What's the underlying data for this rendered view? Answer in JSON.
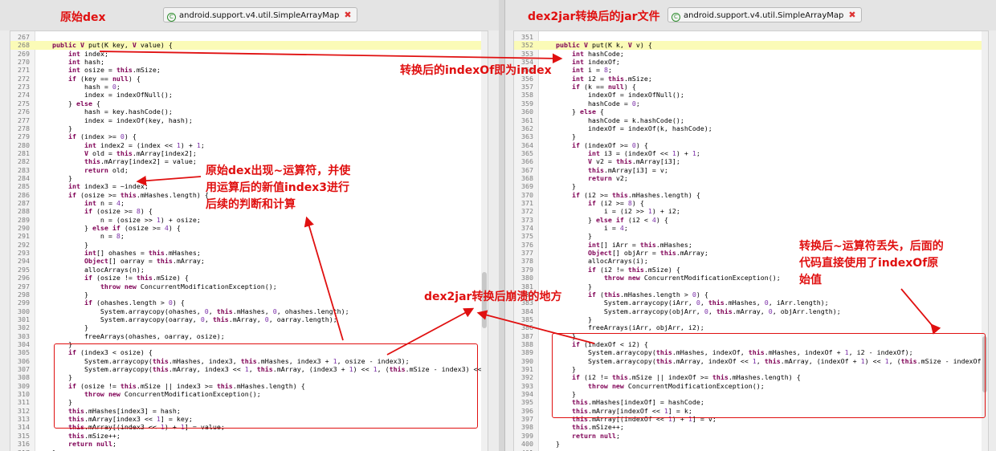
{
  "left": {
    "header_label": "原始dex",
    "tab_label": "android.support.v4.util.SimpleArrayMap",
    "tab_close": "✖",
    "lines": [
      {
        "n": "267",
        "t": ""
      },
      {
        "n": "268",
        "t": "    public V put(K key, V value) {"
      },
      {
        "n": "269",
        "t": "        int index;"
      },
      {
        "n": "270",
        "t": "        int hash;"
      },
      {
        "n": "271",
        "t": "        int osize = this.mSize;"
      },
      {
        "n": "272",
        "t": "        if (key == null) {"
      },
      {
        "n": "273",
        "t": "            hash = 0;"
      },
      {
        "n": "274",
        "t": "            index = indexOfNull();"
      },
      {
        "n": "275",
        "t": "        } else {"
      },
      {
        "n": "276",
        "t": "            hash = key.hashCode();"
      },
      {
        "n": "277",
        "t": "            index = indexOf(key, hash);"
      },
      {
        "n": "278",
        "t": "        }"
      },
      {
        "n": "279",
        "t": "        if (index >= 0) {"
      },
      {
        "n": "280",
        "t": "            int index2 = (index << 1) + 1;"
      },
      {
        "n": "281",
        "t": "            V old = this.mArray[index2];"
      },
      {
        "n": "282",
        "t": "            this.mArray[index2] = value;"
      },
      {
        "n": "283",
        "t": "            return old;"
      },
      {
        "n": "284",
        "t": "        }"
      },
      {
        "n": "285",
        "t": "        int index3 = ~index;"
      },
      {
        "n": "286",
        "t": "        if (osize >= this.mHashes.length) {"
      },
      {
        "n": "287",
        "t": "            int n = 4;"
      },
      {
        "n": "288",
        "t": "            if (osize >= 8) {"
      },
      {
        "n": "289",
        "t": "                n = (osize >> 1) + osize;"
      },
      {
        "n": "290",
        "t": "            } else if (osize >= 4) {"
      },
      {
        "n": "291",
        "t": "                n = 8;"
      },
      {
        "n": "292",
        "t": "            }"
      },
      {
        "n": "293",
        "t": "            int[] ohashes = this.mHashes;"
      },
      {
        "n": "294",
        "t": "            Object[] oarray = this.mArray;"
      },
      {
        "n": "295",
        "t": "            allocArrays(n);"
      },
      {
        "n": "296",
        "t": "            if (osize != this.mSize) {"
      },
      {
        "n": "297",
        "t": "                throw new ConcurrentModificationException();"
      },
      {
        "n": "298",
        "t": "            }"
      },
      {
        "n": "299",
        "t": "            if (ohashes.length > 0) {"
      },
      {
        "n": "300",
        "t": "                System.arraycopy(ohashes, 0, this.mHashes, 0, ohashes.length);"
      },
      {
        "n": "301",
        "t": "                System.arraycopy(oarray, 0, this.mArray, 0, oarray.length);"
      },
      {
        "n": "302",
        "t": "            }"
      },
      {
        "n": "303",
        "t": "            freeArrays(ohashes, oarray, osize);"
      },
      {
        "n": "304",
        "t": "        }"
      },
      {
        "n": "305",
        "t": "        if (index3 < osize) {"
      },
      {
        "n": "306",
        "t": "            System.arraycopy(this.mHashes, index3, this.mHashes, index3 + 1, osize - index3);"
      },
      {
        "n": "307",
        "t": "            System.arraycopy(this.mArray, index3 << 1, this.mArray, (index3 + 1) << 1, (this.mSize - index3) << 1);"
      },
      {
        "n": "308",
        "t": "        }"
      },
      {
        "n": "309",
        "t": "        if (osize != this.mSize || index3 >= this.mHashes.length) {"
      },
      {
        "n": "310",
        "t": "            throw new ConcurrentModificationException();"
      },
      {
        "n": "311",
        "t": "        }"
      },
      {
        "n": "312",
        "t": "        this.mHashes[index3] = hash;"
      },
      {
        "n": "313",
        "t": "        this.mArray[index3 << 1] = key;"
      },
      {
        "n": "314",
        "t": "        this.mArray[(index3 << 1) + 1] = value;"
      },
      {
        "n": "315",
        "t": "        this.mSize++;"
      },
      {
        "n": "316",
        "t": "        return null;"
      },
      {
        "n": "317",
        "t": "    }"
      }
    ]
  },
  "right": {
    "header_label": "dex2jar转换后的jar文件",
    "tab_label": "android.support.v4.util.SimpleArrayMap",
    "tab_close": "✖",
    "lines": [
      {
        "n": "351",
        "t": ""
      },
      {
        "n": "352",
        "t": "    public V put(K k, V v) {"
      },
      {
        "n": "353",
        "t": "        int hashCode;"
      },
      {
        "n": "354",
        "t": "        int indexOf;"
      },
      {
        "n": "355",
        "t": "        int i = 8;"
      },
      {
        "n": "356",
        "t": "        int i2 = this.mSize;"
      },
      {
        "n": "357",
        "t": "        if (k == null) {"
      },
      {
        "n": "358",
        "t": "            indexOf = indexOfNull();"
      },
      {
        "n": "359",
        "t": "            hashCode = 0;"
      },
      {
        "n": "360",
        "t": "        } else {"
      },
      {
        "n": "361",
        "t": "            hashCode = k.hashCode();"
      },
      {
        "n": "362",
        "t": "            indexOf = indexOf(k, hashCode);"
      },
      {
        "n": "363",
        "t": "        }"
      },
      {
        "n": "364",
        "t": "        if (indexOf >= 0) {"
      },
      {
        "n": "365",
        "t": "            int i3 = (indexOf << 1) + 1;"
      },
      {
        "n": "366",
        "t": "            V v2 = this.mArray[i3];"
      },
      {
        "n": "367",
        "t": "            this.mArray[i3] = v;"
      },
      {
        "n": "368",
        "t": "            return v2;"
      },
      {
        "n": "369",
        "t": "        }"
      },
      {
        "n": "370",
        "t": "        if (i2 >= this.mHashes.length) {"
      },
      {
        "n": "371",
        "t": "            if (i2 >= 8) {"
      },
      {
        "n": "372",
        "t": "                i = (i2 >> 1) + i2;"
      },
      {
        "n": "373",
        "t": "            } else if (i2 < 4) {"
      },
      {
        "n": "374",
        "t": "                i = 4;"
      },
      {
        "n": "375",
        "t": "            }"
      },
      {
        "n": "376",
        "t": "            int[] iArr = this.mHashes;"
      },
      {
        "n": "377",
        "t": "            Object[] objArr = this.mArray;"
      },
      {
        "n": "378",
        "t": "            allocArrays(i);"
      },
      {
        "n": "379",
        "t": "            if (i2 != this.mSize) {"
      },
      {
        "n": "380",
        "t": "                throw new ConcurrentModificationException();"
      },
      {
        "n": "381",
        "t": "            }"
      },
      {
        "n": "382",
        "t": "            if (this.mHashes.length > 0) {"
      },
      {
        "n": "383",
        "t": "                System.arraycopy(iArr, 0, this.mHashes, 0, iArr.length);"
      },
      {
        "n": "384",
        "t": "                System.arraycopy(objArr, 0, this.mArray, 0, objArr.length);"
      },
      {
        "n": "385",
        "t": "            }"
      },
      {
        "n": "386",
        "t": "            freeArrays(iArr, objArr, i2);"
      },
      {
        "n": "387",
        "t": "        }"
      },
      {
        "n": "388",
        "t": "        if (indexOf < i2) {"
      },
      {
        "n": "389",
        "t": "            System.arraycopy(this.mHashes, indexOf, this.mHashes, indexOf + 1, i2 - indexOf);"
      },
      {
        "n": "390",
        "t": "            System.arraycopy(this.mArray, indexOf << 1, this.mArray, (indexOf + 1) << 1, (this.mSize - indexOf) << 1);"
      },
      {
        "n": "391",
        "t": "        }"
      },
      {
        "n": "392",
        "t": "        if (i2 != this.mSize || indexOf >= this.mHashes.length) {"
      },
      {
        "n": "393",
        "t": "            throw new ConcurrentModificationException();"
      },
      {
        "n": "394",
        "t": "        }"
      },
      {
        "n": "395",
        "t": "        this.mHashes[indexOf] = hashCode;"
      },
      {
        "n": "396",
        "t": "        this.mArray[indexOf << 1] = k;"
      },
      {
        "n": "397",
        "t": "        this.mArray[(indexOf << 1) + 1] = v;"
      },
      {
        "n": "398",
        "t": "        this.mSize++;"
      },
      {
        "n": "399",
        "t": "        return null;"
      },
      {
        "n": "400",
        "t": "    }"
      },
      {
        "n": "401",
        "t": ""
      }
    ]
  },
  "annotations": {
    "index_note": "转换后的indexOf即为index",
    "tilde_note": "原始dex出现~运算符，并使\n用运算后的新值index3进行\n后续的判断和计算",
    "lost_note": "转换后~运算符丢失，后面的\n代码直接使用了indexOf原\n始值",
    "crash_note": "dex2jar转换后崩溃的地方"
  },
  "colors": {
    "annotation": "#e01010",
    "keyword": "#7f0055",
    "literal": "#7b2fa8",
    "highlight_line": "#fbfbb7"
  }
}
